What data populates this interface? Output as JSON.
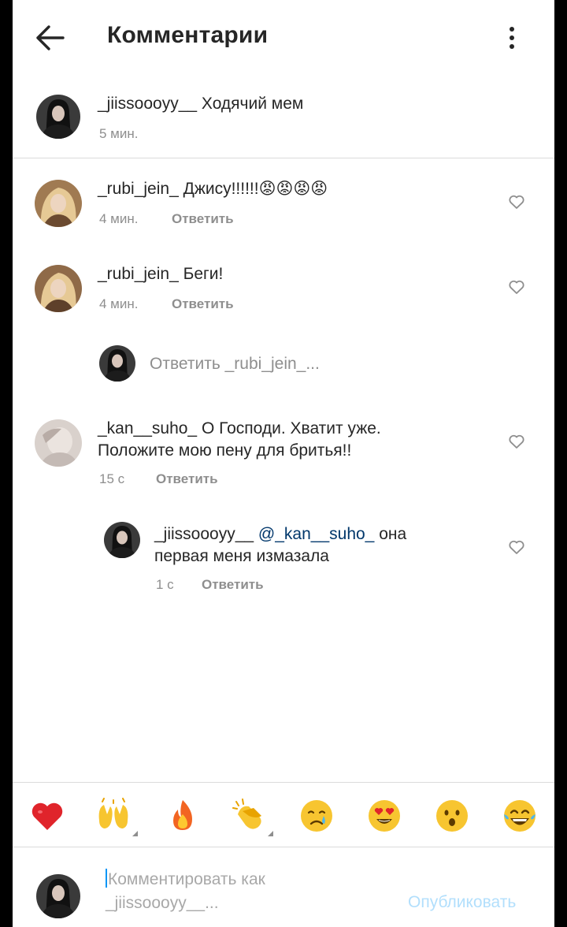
{
  "header": {
    "title": "Комментарии"
  },
  "caption": {
    "username": "_jiissoooyy__",
    "text": "Ходячий мем",
    "time": "5 мин."
  },
  "comments": [
    {
      "username": "_rubi_jein_",
      "text": "Джису!!!!!!😡😡😡😡",
      "time": "4 мин.",
      "reply_label": "Ответить"
    },
    {
      "username": "_rubi_jein_",
      "text": "Беги!",
      "time": "4 мин.",
      "reply_label": "Ответить"
    },
    {
      "username": "_kan__suho_",
      "text_line1": "О Господи. Хватит уже.",
      "text_line2": "Положите мою пену для бритья!!",
      "time": "15 с",
      "reply_label": "Ответить"
    }
  ],
  "reply_prompt": "Ответить _rubi_jein_...",
  "nested_reply": {
    "username": "_jiissoooyy__",
    "mention": "@_kan__suho_",
    "text_line1_after": "она",
    "text_line2": "первая меня измазала",
    "time": "1 с",
    "reply_label": "Ответить"
  },
  "emoji_bar": [
    "red-heart",
    "raising-hands",
    "fire",
    "clapping-hands",
    "crying-face",
    "heart-eyes-face",
    "hushed-face",
    "tears-of-joy-face"
  ],
  "composer": {
    "placeholder_line1": "Комментировать как",
    "placeholder_line2": "_jiissoooyy__...",
    "publish_label": "Опубликовать"
  },
  "colors": {
    "mention": "#00376b",
    "publish_disabled": "#b2dffc",
    "secondary_text": "#8e8e8e"
  }
}
